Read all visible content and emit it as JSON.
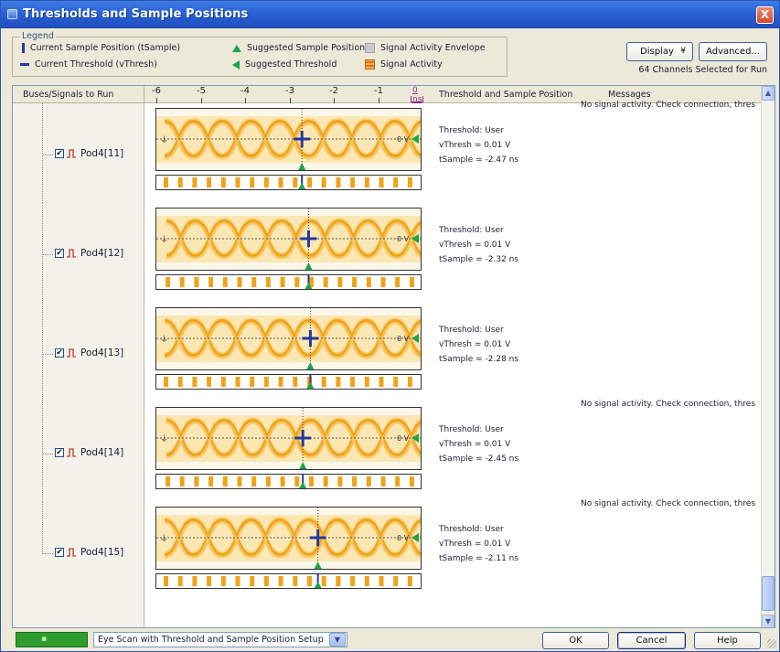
{
  "window": {
    "title": "Thresholds and Sample Positions",
    "close_glyph": "X"
  },
  "legend": {
    "title": "Legend",
    "items": [
      {
        "label": "Current Sample Position (tSample)",
        "icon": "current-sample-marker"
      },
      {
        "label": "Current Threshold (vThresh)",
        "icon": "current-threshold-marker"
      },
      {
        "label": "Suggested Sample Position",
        "icon": "suggested-sample-triangle-up"
      },
      {
        "label": "Suggested Threshold",
        "icon": "suggested-threshold-triangle-left"
      },
      {
        "label": "Signal Activity Envelope",
        "icon": "activity-envelope-swatch"
      },
      {
        "label": "Signal Activity",
        "icon": "signal-activity-swatch"
      }
    ]
  },
  "toolbar": {
    "display_label": "Display",
    "display_chevron": "¥",
    "advanced_label": "Advanced...",
    "channels_selected": "64 Channels Selected for Run"
  },
  "table": {
    "col_signals": "Buses/Signals to Run",
    "col_threshold": "Threshold and Sample Position",
    "col_messages": "Messages",
    "scale_ticks": [
      "-6",
      "-5",
      "-4",
      "-3",
      "-2",
      "-1"
    ],
    "scale_zero": "0 ns",
    "scale_min_ns": -6,
    "scale_max_ns": 0
  },
  "rows": [
    {
      "name": "Pod4[11]",
      "checked": true,
      "zero_label": "0 V",
      "threshold_mode": "Threshold: User",
      "vthresh_label": "vThresh = 0.01 V",
      "tsample_label": "tSample = -2.47 ns",
      "tsample_ns": -2.47,
      "message": "No signal activity. Check connection, thres"
    },
    {
      "name": "Pod4[12]",
      "checked": true,
      "zero_label": "0 V",
      "threshold_mode": "Threshold: User",
      "vthresh_label": "vThresh = 0.01 V",
      "tsample_label": "tSample = -2.32 ns",
      "tsample_ns": -2.32,
      "message": ""
    },
    {
      "name": "Pod4[13]",
      "checked": true,
      "zero_label": "0 V",
      "threshold_mode": "Threshold: User",
      "vthresh_label": "vThresh = 0.01 V",
      "tsample_label": "tSample = -2.28 ns",
      "tsample_ns": -2.28,
      "message": ""
    },
    {
      "name": "Pod4[14]",
      "checked": true,
      "zero_label": "0 V",
      "threshold_mode": "Threshold: User",
      "vthresh_label": "vThresh = 0.01 V",
      "tsample_label": "tSample = -2.45 ns",
      "tsample_ns": -2.45,
      "message": "No signal activity. Check connection, thres"
    },
    {
      "name": "Pod4[15]",
      "checked": true,
      "zero_label": "0 V",
      "threshold_mode": "Threshold: User",
      "vthresh_label": "vThresh = 0.01 V",
      "tsample_label": "tSample = -2.11 ns",
      "tsample_ns": -2.11,
      "message": "No signal activity. Check connection, thres"
    }
  ],
  "footer": {
    "mode_label": "Eye Scan with Threshold and Sample Position Setup",
    "ok_label": "OK",
    "cancel_label": "Cancel",
    "help_label": "Help"
  },
  "colors": {
    "eye_main": "#f0a318",
    "eye_light": "#f7c96a",
    "envelope": "#fbe7b3",
    "marker_blue": "#28389e",
    "marker_green": "#1aa54a",
    "title_bar": "#2a62d6"
  }
}
